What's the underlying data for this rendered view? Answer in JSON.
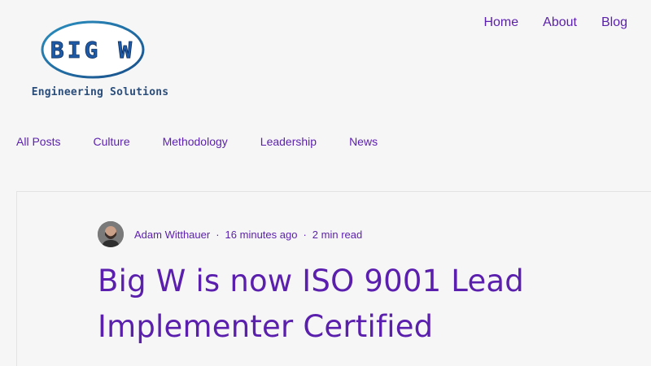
{
  "logo": {
    "wordmark": "BIG W",
    "tagline": "Engineering Solutions"
  },
  "top_nav": {
    "items": [
      "Home",
      "About",
      "Blog"
    ]
  },
  "category_nav": {
    "items": [
      "All Posts",
      "Culture",
      "Methodology",
      "Leadership",
      "News"
    ]
  },
  "post": {
    "author": "Adam Witthauer",
    "time_ago": "16 minutes ago",
    "read_time": "2 min read",
    "separator": "·",
    "title": "Big W is now ISO 9001 Lead Implementer Certified"
  },
  "colors": {
    "link": "#5b1fae",
    "background": "#f6f6f6",
    "logo_text": "#2a4d7a"
  }
}
